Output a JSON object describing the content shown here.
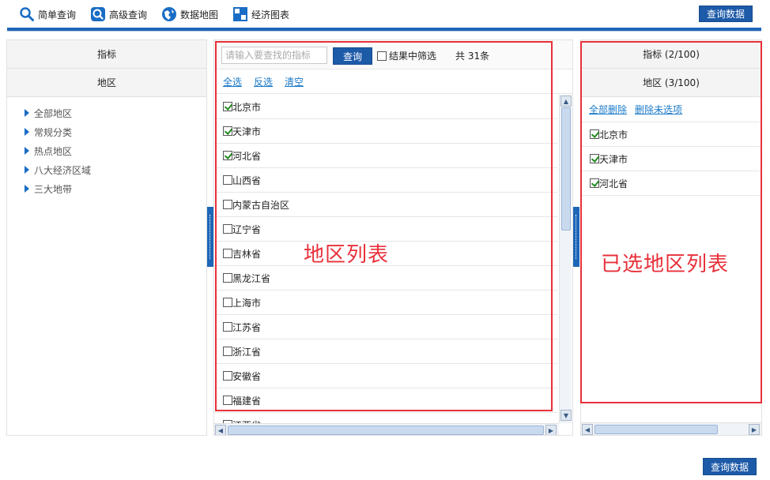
{
  "toolbar": {
    "items": [
      {
        "label": "简单查询",
        "icon": "search-icon"
      },
      {
        "label": "高级查询",
        "icon": "advanced-search-icon"
      },
      {
        "label": "数据地图",
        "icon": "map-icon"
      },
      {
        "label": "经济图表",
        "icon": "chart-icon"
      }
    ],
    "query_button": "查询数据"
  },
  "left_panel": {
    "tabs": [
      "指标",
      "地区"
    ],
    "tree": [
      "全部地区",
      "常规分类",
      "热点地区",
      "八大经济区域",
      "三大地带"
    ]
  },
  "middle_panel": {
    "search_placeholder": "请输入要查找的指标",
    "search_button": "查询",
    "filter_label": "结果中筛选",
    "count_text": "共 31条",
    "links": [
      "全选",
      "反选",
      "清空"
    ],
    "regions": [
      {
        "name": "北京市",
        "checked": true
      },
      {
        "name": "天津市",
        "checked": true
      },
      {
        "name": "河北省",
        "checked": true
      },
      {
        "name": "山西省",
        "checked": false
      },
      {
        "name": "内蒙古自治区",
        "checked": false
      },
      {
        "name": "辽宁省",
        "checked": false
      },
      {
        "name": "吉林省",
        "checked": false
      },
      {
        "name": "黑龙江省",
        "checked": false
      },
      {
        "name": "上海市",
        "checked": false
      },
      {
        "name": "江苏省",
        "checked": false
      },
      {
        "name": "浙江省",
        "checked": false
      },
      {
        "name": "安徽省",
        "checked": false
      },
      {
        "name": "福建省",
        "checked": false
      },
      {
        "name": "江西省",
        "checked": false
      }
    ],
    "annotation": "地区列表"
  },
  "right_panel": {
    "tabs": [
      "指标 (2/100)",
      "地区 (3/100)"
    ],
    "links": [
      "全部删除",
      "删除未选项"
    ],
    "selected": [
      "北京市",
      "天津市",
      "河北省"
    ],
    "annotation": "已选地区列表"
  },
  "bottom_button": "查询数据",
  "colors": {
    "accent": "#1e66b8",
    "button": "#1d5aa8",
    "annotation": "#e8303a",
    "link": "#1a7ac9"
  }
}
